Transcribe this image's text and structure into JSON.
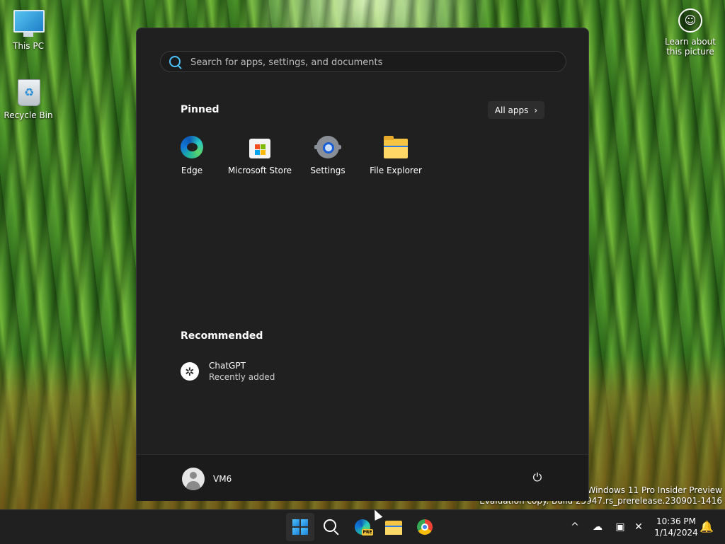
{
  "desktop": {
    "icons": [
      {
        "label": "This PC"
      },
      {
        "label": "Recycle Bin"
      }
    ],
    "learn_about": "Learn about this picture",
    "watermark_line1": "Windows 11 Pro Insider Preview",
    "watermark_line2": "Evaluation copy. Build 25947.rs_prerelease.230901-1416"
  },
  "start_menu": {
    "search_placeholder": "Search for apps, settings, and documents",
    "pinned_title": "Pinned",
    "all_apps_label": "All apps",
    "pinned": [
      {
        "label": "Edge",
        "icon": "edge-icon"
      },
      {
        "label": "Microsoft Store",
        "icon": "store-icon"
      },
      {
        "label": "Settings",
        "icon": "gear-icon"
      },
      {
        "label": "File Explorer",
        "icon": "folder-icon"
      }
    ],
    "recommended_title": "Recommended",
    "recommended": [
      {
        "name": "ChatGPT",
        "sub": "Recently added",
        "icon": "chatgpt-icon"
      }
    ],
    "user": "VM6"
  },
  "taskbar": {
    "time": "10:36 PM",
    "date": "1/14/2024",
    "edge_badge": "PRE"
  },
  "colors": {
    "accent": "#4cc2ff",
    "menu_bg": "#202020",
    "taskbar_bg": "#202020"
  }
}
